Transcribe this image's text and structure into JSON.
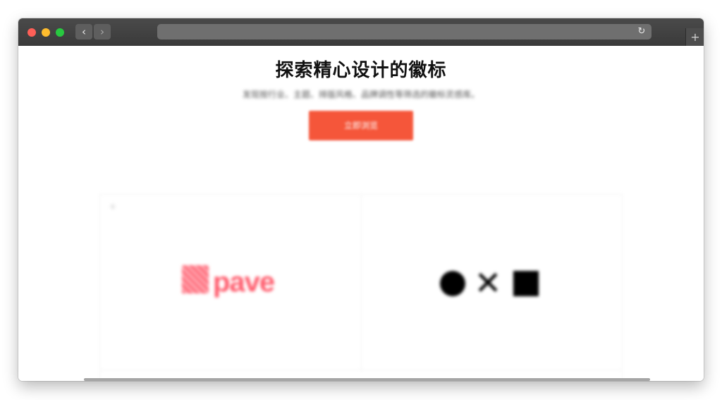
{
  "browser": {
    "back_glyph": "‹",
    "forward_glyph": "›",
    "reload_glyph": "↻",
    "new_tab_glyph": "+",
    "traffic_lights": [
      "close",
      "minimize",
      "zoom"
    ]
  },
  "hero": {
    "title": "探索精心设计的徽标",
    "subtitle": "发现按行业、主题、排版风格、品牌调性等筛选的徽标灵感库。",
    "cta_label": "立即浏览",
    "cta_color": "#f5563a"
  },
  "gallery": {
    "items": [
      {
        "name": "pave",
        "logo_text": "pave",
        "mark": "①",
        "brand_color": "#ff5a6b"
      },
      {
        "name": "circle-x-square",
        "glyph_x": "✕",
        "brand_color": "#000000"
      }
    ]
  }
}
